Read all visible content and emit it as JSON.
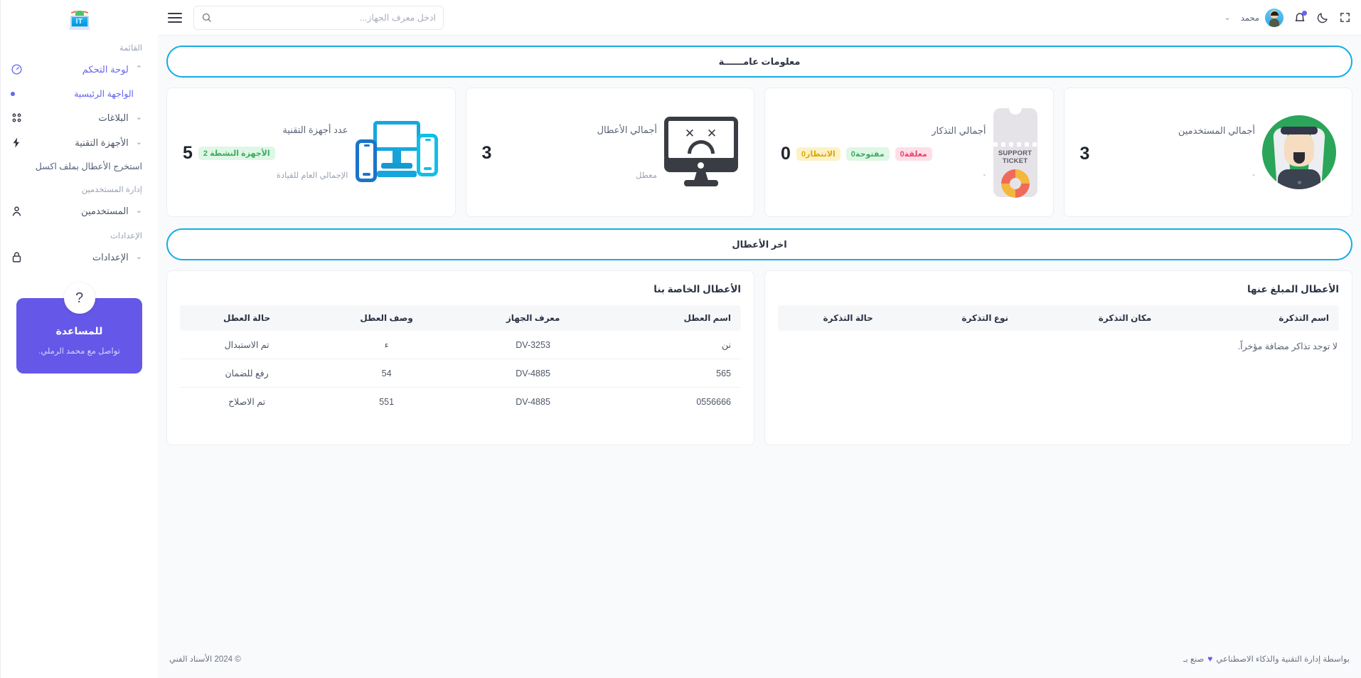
{
  "app": {
    "logo_text": "IT"
  },
  "topbar": {
    "hamburger_icon": "hamburger-menu-icon",
    "search": {
      "placeholder": "ادخل معرف الجهاز...",
      "value": "",
      "icon": "search-icon"
    },
    "fullscreen_icon": "fullscreen-icon",
    "darkmode_icon": "moon-icon",
    "notifications_icon": "bell-icon",
    "user_name": "محمد",
    "caret_icon": "chevron-down-icon"
  },
  "sidebar": {
    "menu_label": "القائمة",
    "items": [
      {
        "label": "لوحة التحكم",
        "icon": "dashboard-gauge-icon",
        "chevron": "⌃",
        "active": true
      },
      {
        "label": "الواجهة الرئيسية",
        "icon": "bullet-dot-icon",
        "sub": true
      },
      {
        "label": "البلاغات",
        "icon": "grid-apps-icon",
        "chevron": "⌄"
      },
      {
        "label": "الأجهزة التقنية",
        "icon": "lightning-bolt-icon",
        "chevron": "⌄"
      }
    ],
    "export_link": "استخرج الأعطال بملف اكسل",
    "users_group_label": "إدارة المستخدمين",
    "users_item": {
      "label": "المستخدمين",
      "icon": "user-icon",
      "chevron": "⌄"
    },
    "settings_group_label": "الإعدادات",
    "settings_item": {
      "label": "الإعدادات",
      "icon": "lock-icon",
      "chevron": "⌄"
    },
    "help": {
      "icon": "question-mark-icon",
      "title": "للمساعدة",
      "subtitle": "تواصل مع محمد الرملي."
    }
  },
  "banners": {
    "general_info": "معلومات عامــــــة",
    "latest_faults": "اخر الأعطال"
  },
  "stats": [
    {
      "id": "devices",
      "title": "عدد أجهزة التقنية",
      "value": "5",
      "badge": {
        "text": "الأجهزة النشطة 2",
        "color": "green"
      },
      "sub": "الإجمالي العام للقيادة",
      "art": "devices-illustration"
    },
    {
      "id": "faults",
      "title": "أجمالي الأعطال",
      "value": "3",
      "sub": "معطل",
      "art": "sad-monitor-illustration"
    },
    {
      "id": "tickets",
      "title": "أجمالي التذكار",
      "value": "0",
      "sub": "-",
      "badges": [
        {
          "text": "الانتظار0",
          "color": "yellow"
        },
        {
          "text": "مفتوحة0",
          "color": "green"
        },
        {
          "text": "معلقة0",
          "color": "pink"
        }
      ],
      "art": "support-ticket-illustration",
      "ticket_label_line1": "SUPPORT",
      "ticket_label_line2": "TICKET"
    },
    {
      "id": "users",
      "title": "أجمالي المستخدمين",
      "value": "3",
      "sub": "-",
      "art": "user-avatar-illustration"
    }
  ],
  "tables": {
    "faults": {
      "title": "الأعطال الخاصة بنا",
      "headers": [
        "اسم العطل",
        "معرف الجهاز",
        "وصف العطل",
        "حالة العطل"
      ],
      "rows": [
        [
          "نن",
          "DV-3253",
          "ء",
          "تم الاستبدال"
        ],
        [
          "565",
          "DV-4885",
          "54",
          "رفع للضمان"
        ],
        [
          "0556666",
          "DV-4885",
          "551",
          "تم الاصلاح"
        ]
      ]
    },
    "tickets": {
      "title": "الأعطال المبلغ عنها",
      "headers": [
        "اسم التذكرة",
        "مكان التذكرة",
        "نوع التذكرة",
        "حالة التذكرة"
      ],
      "rows": [],
      "empty_message": "لا توجد تذاكر مضافة مؤخراً."
    }
  },
  "footer": {
    "copyright": "© 2024 الأسناد الفني",
    "made_prefix": "صنع بـ",
    "heart": "♥",
    "made_suffix": "بواسطة إدارة التقنية والذكاء الاصطناعي"
  },
  "colors": {
    "accent_blue": "#14aee4",
    "brand_purple": "#6558e8",
    "green": "#3cab5f",
    "pink": "#e8436f",
    "yellow": "#d9a80a"
  }
}
